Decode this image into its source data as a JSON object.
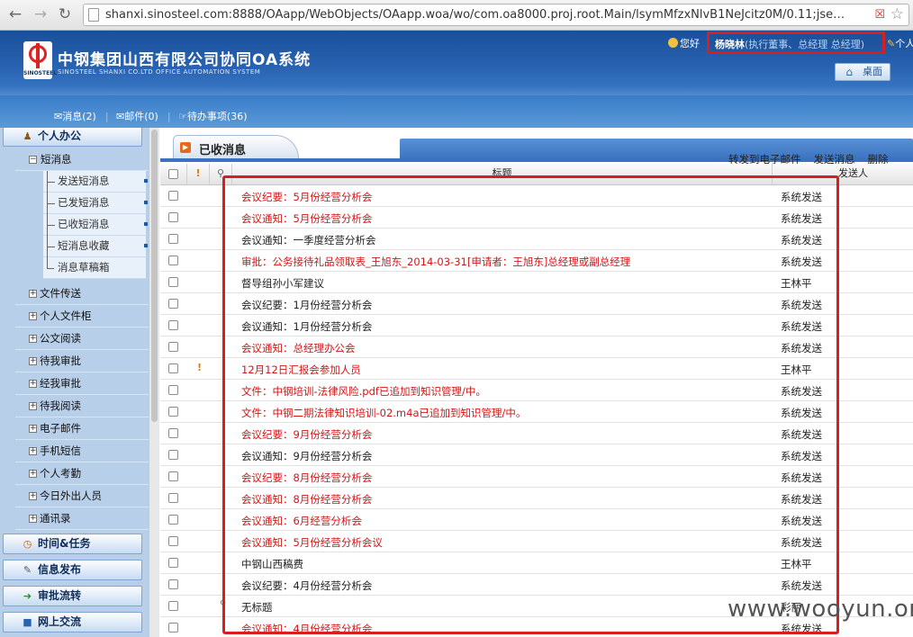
{
  "browser": {
    "url": "shanxi.sinosteel.com:8888/OAapp/WebObjects/OAapp.woa/wo/com.oa8000.proj.root.Main/lsymMfzxNlvB1NeJcitz0M/0.11;jse…"
  },
  "header": {
    "title": "中钢集团山西有限公司协同OA系统",
    "subtitle": "SINOSTEEL SHANXI CO.LTD OFFICE AUTOMATION SYSTEM",
    "logo_text": "SINOSTEEL",
    "greeting": "您好",
    "user_name": "杨晓林",
    "user_role": "(执行董事、总经理 总经理)",
    "personal_label": "个人",
    "desktop_label": "桌面",
    "quick_links": [
      "消息(2)",
      "邮件(0)",
      "待办事项(36)"
    ]
  },
  "sidebar": {
    "category_personal": "个人办公",
    "sms": "短消息",
    "sms_items": [
      "发送短消息",
      "已发短消息",
      "已收短消息",
      "短消息收藏",
      "消息草稿箱"
    ],
    "modules": [
      "文件传送",
      "个人文件柜",
      "公文阅读",
      "待我审批",
      "经我审批",
      "待我阅读",
      "电子邮件",
      "手机短信",
      "个人考勤",
      "今日外出人员",
      "通讯录"
    ],
    "bottom_categories": [
      "时间&任务",
      "信息发布",
      "审批流转",
      "网上交流"
    ]
  },
  "main": {
    "tab_title": "已收消息",
    "actions": [
      "转发到电子邮件",
      "发送消息",
      "删除"
    ],
    "col_title": "标题",
    "col_sender": "发送人",
    "rows": [
      {
        "title": "会议纪要：5月份经营分析会",
        "sender": "系统发送",
        "important": false,
        "attachment": false
      },
      {
        "title": "会议通知：5月份经营分析会",
        "sender": "系统发送",
        "important": false,
        "attachment": false
      },
      {
        "title": "会议通知：一季度经营分析会",
        "sender": "系统发送",
        "important": false,
        "attachment": false
      },
      {
        "title": "审批：公务接待礼品领取表_王旭东_2014-03-31[申请者：王旭东]总经理或副总经理",
        "sender": "系统发送",
        "important": false,
        "attachment": false
      },
      {
        "title": "督导组孙小军建议",
        "sender": "王林平",
        "important": false,
        "attachment": false
      },
      {
        "title": "会议纪要：1月份经营分析会",
        "sender": "系统发送",
        "important": false,
        "attachment": false
      },
      {
        "title": "会议通知：1月份经营分析会",
        "sender": "系统发送",
        "important": false,
        "attachment": false
      },
      {
        "title": "会议通知：总经理办公会",
        "sender": "系统发送",
        "important": false,
        "attachment": false
      },
      {
        "title": "12月12日汇报会参加人员",
        "sender": "王林平",
        "important": true,
        "attachment": false
      },
      {
        "title": "文件：中钢培训-法律风险.pdf已追加到知识管理/中。",
        "sender": "系统发送",
        "important": false,
        "attachment": false
      },
      {
        "title": "文件：中钢二期法律知识培训-02.m4a已追加到知识管理/中。",
        "sender": "系统发送",
        "important": false,
        "attachment": false
      },
      {
        "title": "会议纪要：9月份经营分析会",
        "sender": "系统发送",
        "important": false,
        "attachment": false
      },
      {
        "title": "会议通知：9月份经营分析会",
        "sender": "系统发送",
        "important": false,
        "attachment": false
      },
      {
        "title": "会议纪要：8月份经营分析会",
        "sender": "系统发送",
        "important": false,
        "attachment": false
      },
      {
        "title": "会议通知：8月份经营分析会",
        "sender": "系统发送",
        "important": false,
        "attachment": false
      },
      {
        "title": "会议通知：6月经营分析会",
        "sender": "系统发送",
        "important": false,
        "attachment": false
      },
      {
        "title": "会议通知：5月份经营分析会议",
        "sender": "系统发送",
        "important": false,
        "attachment": false
      },
      {
        "title": "中钢山西稿费",
        "sender": "王林平",
        "important": false,
        "attachment": false
      },
      {
        "title": "会议纪要：4月份经营分析会",
        "sender": "系统发送",
        "important": false,
        "attachment": false
      },
      {
        "title": "无标题",
        "sender": "彩丽",
        "important": false,
        "attachment": true
      },
      {
        "title": "会议通知：4月份经营分析会",
        "sender": "系统发送",
        "important": false,
        "attachment": false
      }
    ]
  },
  "watermark": "www.wooyun.org",
  "colors": {
    "unread": "#d41515",
    "read": "#222222",
    "highlight_box": "#d81f1f"
  }
}
